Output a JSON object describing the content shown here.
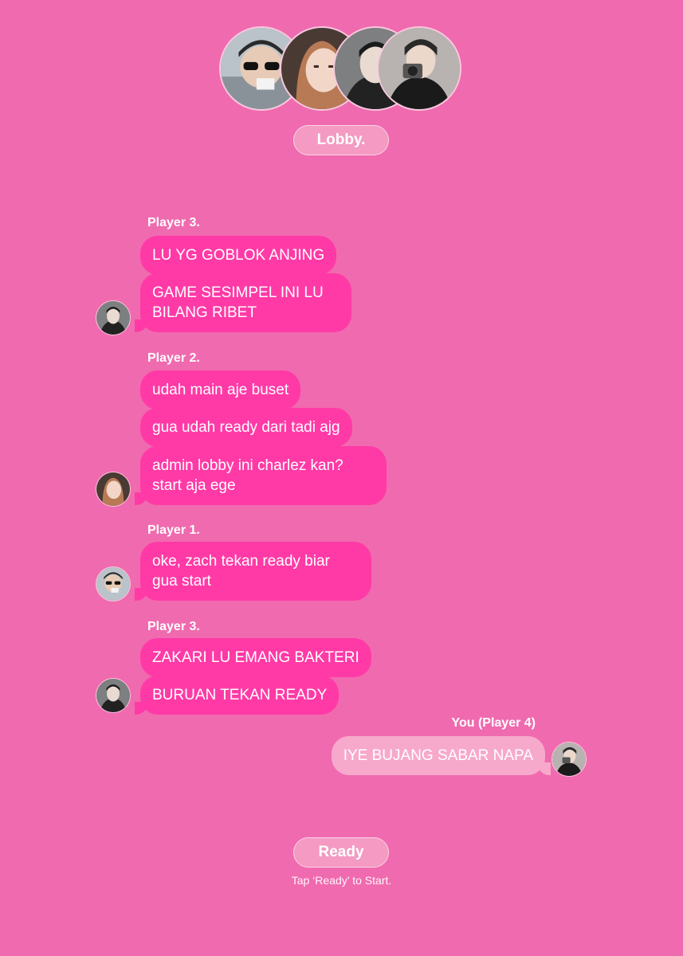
{
  "colors": {
    "background": "#f06aaf",
    "bubble_other": "#ff3aa6",
    "bubble_me": "#f7a9cc",
    "pill_bg": "#f49ac3"
  },
  "header": {
    "lobby_label": "Lobby.",
    "avatars": [
      "player-1-avatar",
      "player-2-avatar",
      "player-3-avatar",
      "player-4-avatar"
    ]
  },
  "messages": [
    {
      "sender": "Player 3.",
      "bubbles": [
        "LU YG GOBLOK ANJING",
        "GAME SESIMPEL INI LU\nBILANG RIBET"
      ]
    },
    {
      "sender": "Player 2.",
      "bubbles": [
        "udah main aje buset",
        "gua udah ready dari tadi ajg",
        "admin lobby ini charlez kan?\nstart aja ege"
      ]
    },
    {
      "sender": "Player 1.",
      "bubbles": [
        "oke, zach tekan ready biar\ngua start"
      ]
    },
    {
      "sender": "Player 3.",
      "bubbles": [
        "ZAKARI LU EMANG BAKTERI",
        "BURUAN TEKAN READY"
      ]
    },
    {
      "sender": "You (Player 4)",
      "bubbles": [
        "IYE BUJANG SABAR NAPA"
      ]
    }
  ],
  "footer": {
    "ready_label": "Ready",
    "hint": "Tap ‘Ready’ to Start."
  }
}
